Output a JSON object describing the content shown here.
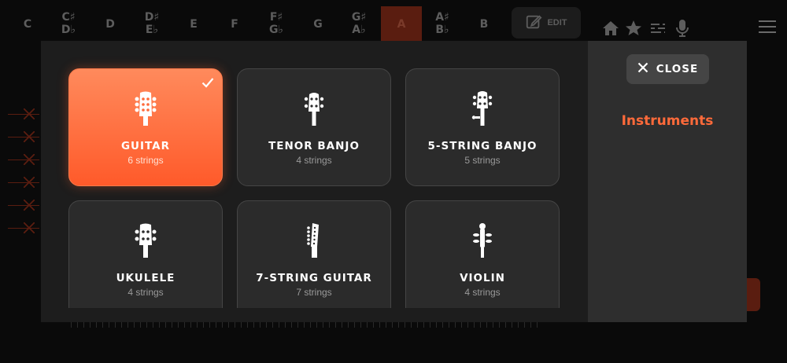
{
  "background": {
    "keys": [
      {
        "label": "C"
      },
      {
        "top": "C♯",
        "bottom": "D♭"
      },
      {
        "label": "D"
      },
      {
        "top": "D♯",
        "bottom": "E♭"
      },
      {
        "label": "E"
      },
      {
        "label": "F"
      },
      {
        "top": "F♯",
        "bottom": "G♭"
      },
      {
        "label": "G"
      },
      {
        "top": "G♯",
        "bottom": "A♭"
      },
      {
        "label": "A"
      },
      {
        "top": "A♯",
        "bottom": "B♭"
      },
      {
        "label": "B"
      }
    ],
    "active_key": "A",
    "edit_label": "EDIT",
    "icons": [
      "home-icon",
      "star-icon",
      "tuning-icon",
      "mic-icon",
      "menu-icon"
    ]
  },
  "modal": {
    "close_label": "CLOSE",
    "panel_title": "Instruments",
    "instruments": [
      {
        "name": "GUITAR",
        "strings": "6 strings",
        "selected": true
      },
      {
        "name": "TENOR BANJO",
        "strings": "4 strings",
        "selected": false
      },
      {
        "name": "5-STRING BANJO",
        "strings": "5 strings",
        "selected": false
      },
      {
        "name": "UKULELE",
        "strings": "4 strings",
        "selected": false
      },
      {
        "name": "7-STRING GUITAR",
        "strings": "7 strings",
        "selected": false
      },
      {
        "name": "VIOLIN",
        "strings": "4 strings",
        "selected": false
      }
    ]
  },
  "colors": {
    "accent": "#ff6a3a",
    "modal_bg": "#1d1d1d",
    "panel_bg": "#2e2e2e",
    "card_bg": "#2b2b2b"
  }
}
